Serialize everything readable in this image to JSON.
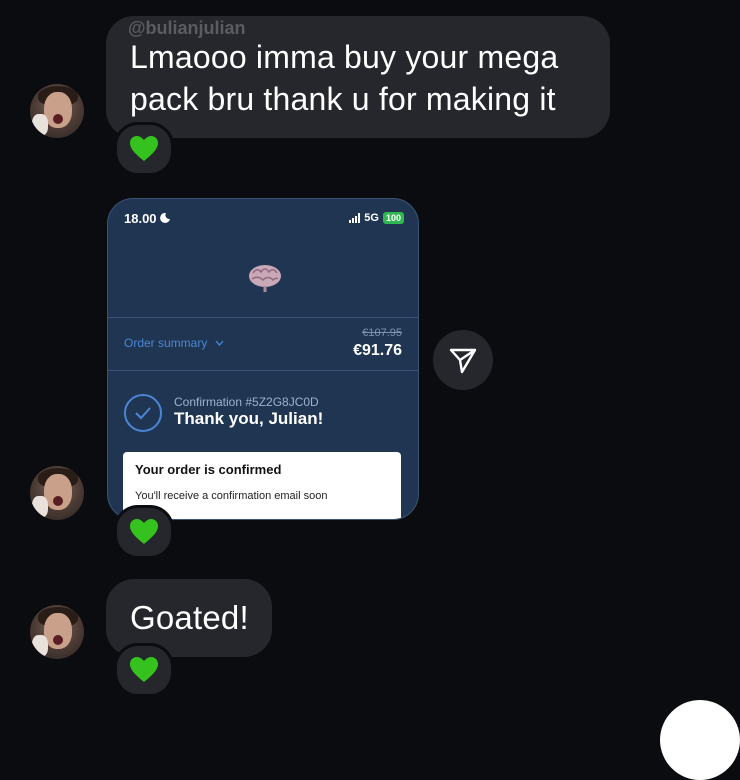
{
  "thread": {
    "username": "@bulianjulian",
    "message_1": {
      "line_1": "Lmaooo imma buy your mega",
      "line_2": "pack bru thank u for making it",
      "reaction": "💚"
    },
    "shared_post": {
      "status_time": "18.00",
      "network": "5G",
      "battery": "100",
      "order_summary_label": "Order summary",
      "old_price": "€107.95",
      "new_price": "€91.76",
      "confirmation_number": "Confirmation #5Z2G8JC0D",
      "thanks_text": "Thank you, Julian!",
      "confirmed_title": "Your order is confirmed",
      "confirmed_subtitle": "You'll receive a confirmation email soon",
      "reaction": "💚"
    },
    "message_2": {
      "text": "Goated!",
      "reaction": "💚"
    }
  },
  "icons": {
    "share": "paper-plane-icon",
    "moon": "moon-icon",
    "chevron": "chevron-down-icon",
    "check": "check-icon",
    "brain": "brain-icon"
  },
  "colors": {
    "background": "#0b0c10",
    "bubble": "#26272c",
    "card": "#1f3552",
    "accent_blue": "#4b86d6",
    "battery_green": "#2fb84f",
    "heart_green": "#35c21e"
  }
}
